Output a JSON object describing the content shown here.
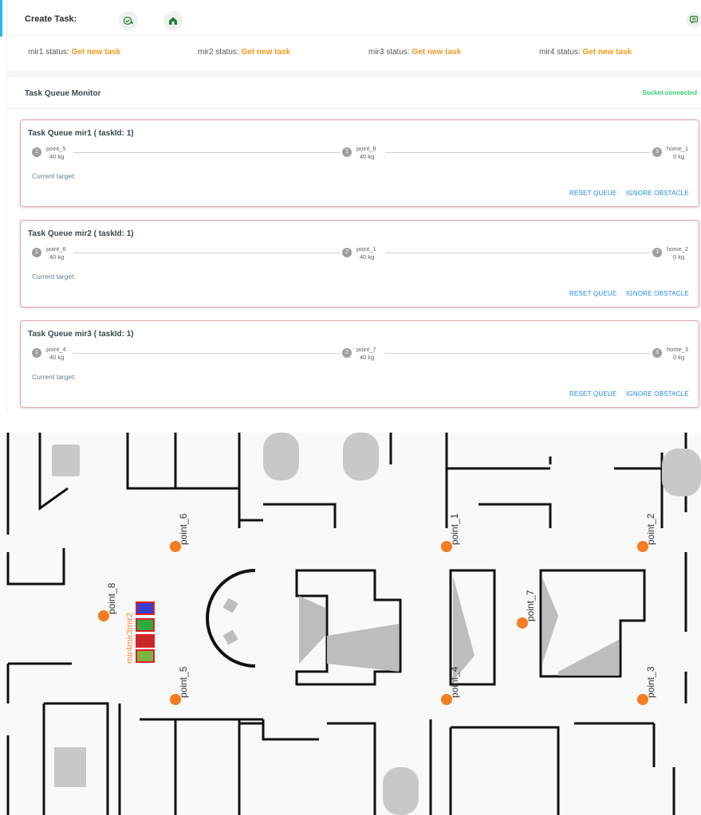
{
  "header": {
    "title": "Create Task:",
    "icons": [
      "add-task-icon",
      "home-icon",
      "message-icon"
    ]
  },
  "robots": [
    {
      "label": "mir1 status:",
      "status": "Get new task"
    },
    {
      "label": "mir2 status:",
      "status": "Get new task"
    },
    {
      "label": "mir3 status:",
      "status": "Get new task"
    },
    {
      "label": "mir4 status:",
      "status": "Get new task"
    }
  ],
  "monitor": {
    "title": "Task Queue Monitor",
    "socket_status": "Socket connected",
    "socket_color": "#2ecc71"
  },
  "queues": [
    {
      "title": "Task Queue mir1 ( taskId: 1)",
      "steps": [
        {
          "num": "1",
          "name": "point_5",
          "kg": "40 kg"
        },
        {
          "num": "2",
          "name": "point_8",
          "kg": "40 kg"
        },
        {
          "num": "3",
          "name": "home_1",
          "kg": "0 kg"
        }
      ],
      "current_target": "Current target:",
      "reset_label": "RESET QUEUE",
      "ignore_label": "IGNORE OBSTACLE"
    },
    {
      "title": "Task Queue mir2 ( taskId: 1)",
      "steps": [
        {
          "num": "1",
          "name": "point_6",
          "kg": "40 kg"
        },
        {
          "num": "2",
          "name": "point_1",
          "kg": "40 kg"
        },
        {
          "num": "3",
          "name": "home_2",
          "kg": "0 kg"
        }
      ],
      "current_target": "Current target:",
      "reset_label": "RESET QUEUE",
      "ignore_label": "IGNORE OBSTACLE"
    },
    {
      "title": "Task Queue mir3 ( taskId: 1)",
      "steps": [
        {
          "num": "1",
          "name": "point_4",
          "kg": "40 kg"
        },
        {
          "num": "2",
          "name": "point_7",
          "kg": "40 kg"
        },
        {
          "num": "3",
          "name": "home_3",
          "kg": "0 kg"
        }
      ],
      "current_target": "Current target:",
      "reset_label": "RESET QUEUE",
      "ignore_label": "IGNORE OBSTACLE"
    }
  ],
  "map": {
    "points": [
      "point_1",
      "point_2",
      "point_3",
      "point_4",
      "point_5",
      "point_6",
      "point_7",
      "point_8"
    ],
    "robot_labels": "mir4mir3mir2",
    "point_color": "#f57c20",
    "robot_colors": [
      "#3b3fd0",
      "#2eaa3e",
      "#c62828",
      "#7cb342"
    ]
  },
  "colors": {
    "accent": "#29b6f6",
    "status_orange": "#f39a1e",
    "link_blue": "#1e88e5",
    "panel_border": "#e7a2a9"
  }
}
